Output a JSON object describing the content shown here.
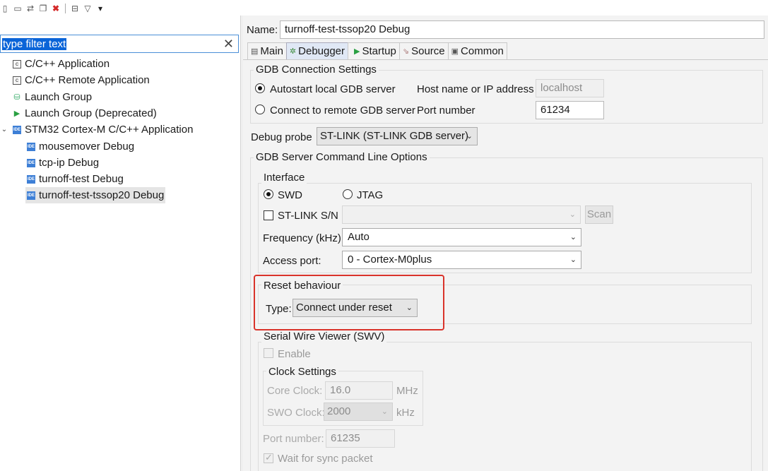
{
  "left": {
    "filter_text": "type filter text",
    "tree": [
      {
        "label": "C/C++ Application",
        "icon": "c-app-icon"
      },
      {
        "label": "C/C++ Remote Application",
        "icon": "c-app-icon"
      },
      {
        "label": "Launch Group",
        "icon": "launch-group-icon"
      },
      {
        "label": "Launch Group (Deprecated)",
        "icon": "play-icon"
      },
      {
        "label": "STM32 Cortex-M C/C++ Application",
        "icon": "ide-icon"
      },
      {
        "label": "mousemover Debug",
        "icon": "ide-icon"
      },
      {
        "label": "tcp-ip Debug",
        "icon": "ide-icon"
      },
      {
        "label": "turnoff-test Debug",
        "icon": "ide-icon"
      },
      {
        "label": "turnoff-test-tssop20 Debug",
        "icon": "ide-icon"
      }
    ]
  },
  "right": {
    "name_label": "Name:",
    "name_value": "turnoff-test-tssop20 Debug",
    "tabs": [
      "Main",
      "Debugger",
      "Startup",
      "Source",
      "Common"
    ],
    "gdb_conn": {
      "title": "GDB Connection Settings",
      "autostart": "Autostart local GDB server",
      "connect_remote": "Connect to remote GDB server",
      "host_label": "Host name or IP address",
      "host_value": "localhost",
      "port_label": "Port number",
      "port_value": "61234"
    },
    "probe_label": "Debug probe",
    "probe_value": "ST-LINK (ST-LINK GDB server)",
    "gdb_server_title": "GDB Server Command Line Options",
    "interface": {
      "title": "Interface",
      "swd": "SWD",
      "jtag": "JTAG",
      "stlink_sn": "ST-LINK S/N",
      "scan": "Scan",
      "freq_label": "Frequency (kHz):",
      "freq_value": "Auto",
      "access_label": "Access port:",
      "access_value": "0 - Cortex-M0plus"
    },
    "reset": {
      "title": "Reset behaviour",
      "type_label": "Type:",
      "type_value": "Connect under reset"
    },
    "swv": {
      "title": "Serial Wire Viewer (SWV)",
      "enable": "Enable",
      "clock_title": "Clock Settings",
      "core_label": "Core Clock:",
      "core_value": "16.0",
      "core_unit": "MHz",
      "swo_label": "SWO Clock:",
      "swo_value": "2000",
      "swo_unit": "kHz",
      "port_label": "Port number:",
      "port_value": "61235",
      "wait_sync": "Wait for sync packet"
    }
  },
  "colors": {
    "highlight_box": "#d9332b",
    "selection": "#0a64d8"
  }
}
